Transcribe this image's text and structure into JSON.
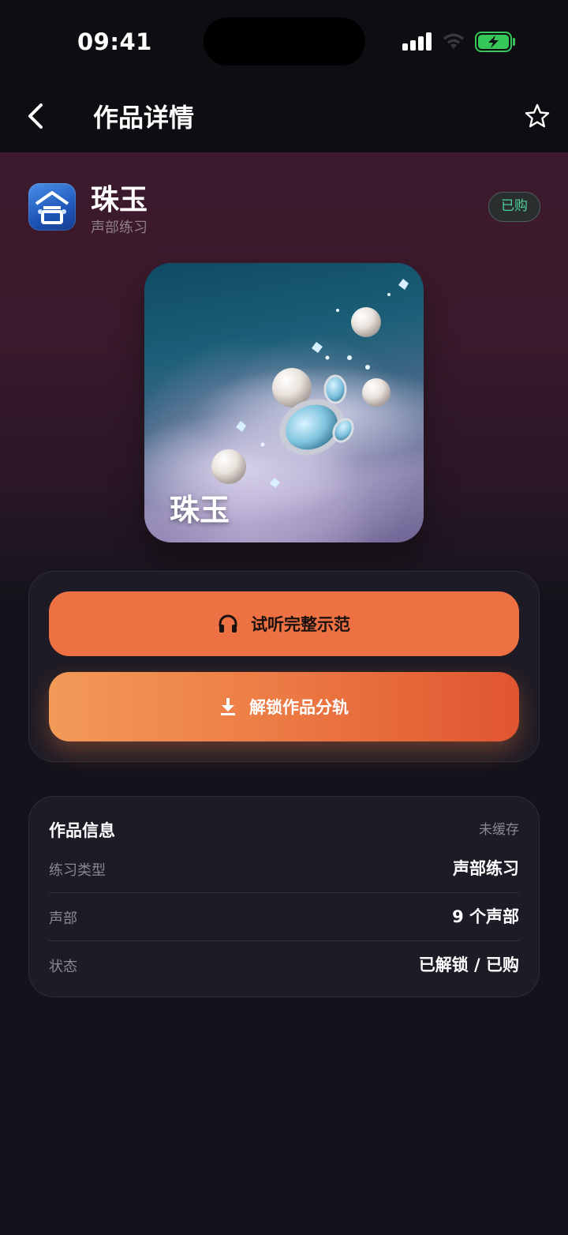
{
  "status_bar": {
    "time": "09:41"
  },
  "nav": {
    "title": "作品详情",
    "back_icon": "chevron-left-icon",
    "favorite_icon": "star-outline-icon"
  },
  "work": {
    "app_icon": "choir-app-icon",
    "title": "珠玉",
    "subtitle": "声部练习",
    "badge": "已购",
    "cover_title": "珠玉"
  },
  "actions": {
    "listen_label": "试听完整示范",
    "listen_icon": "headphones-icon",
    "unlock_label": "解锁作品分轨",
    "unlock_icon": "download-icon"
  },
  "info": {
    "title": "作品信息",
    "cache_status": "未缓存",
    "rows": [
      {
        "key": "练习类型",
        "value": "声部练习"
      },
      {
        "key": "声部",
        "value": "9 个声部"
      },
      {
        "key": "状态",
        "value": "已解锁 / 已购"
      }
    ]
  },
  "colors": {
    "accent_orange": "#ee7143",
    "badge_green": "#4bd39a",
    "background": "#14131c"
  }
}
